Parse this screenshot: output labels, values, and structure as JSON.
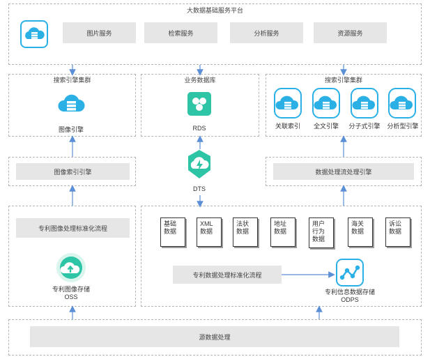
{
  "top": {
    "title": "大数据基础服务平台",
    "services": [
      "图片服务",
      "检索服务",
      "分析服务",
      "资源服务"
    ]
  },
  "left_cluster": {
    "title": "搜索引擎集群",
    "icon_label": "图像引擎"
  },
  "middle_db": {
    "title": "业务数据库",
    "rds_label": "RDS",
    "dts_label": "DTS"
  },
  "right_cluster": {
    "title": "搜索引擎集群",
    "engines": [
      "关联索引",
      "全文引擎",
      "分子式引擎",
      "分析型引擎"
    ]
  },
  "left_mid": {
    "label": "图像索引引擎"
  },
  "right_mid": {
    "label": "数据处理流处理引擎"
  },
  "left_bottom": {
    "process_label": "专利图像处理标准化流程",
    "storage_label_line1": "专利图像存储",
    "storage_label_line2": "OSS"
  },
  "right_bottom": {
    "docs": [
      "基础\n数据",
      "XML\n数据",
      "法状\n数据",
      "地址\n数据",
      "用户\n行为\n数据",
      "海关\n数据",
      "诉讼\n数据"
    ],
    "process_label": "专利数据处理标准化流程",
    "storage_label_line1": "专利信息数据存储",
    "storage_label_line2": "ODPS"
  },
  "source": {
    "label": "源数据处理"
  },
  "colors": {
    "accent": "#2bb0e6",
    "green": "#2ec4a6",
    "gray_fill": "#e6e6e6",
    "arrow": "#5b8fd6"
  }
}
